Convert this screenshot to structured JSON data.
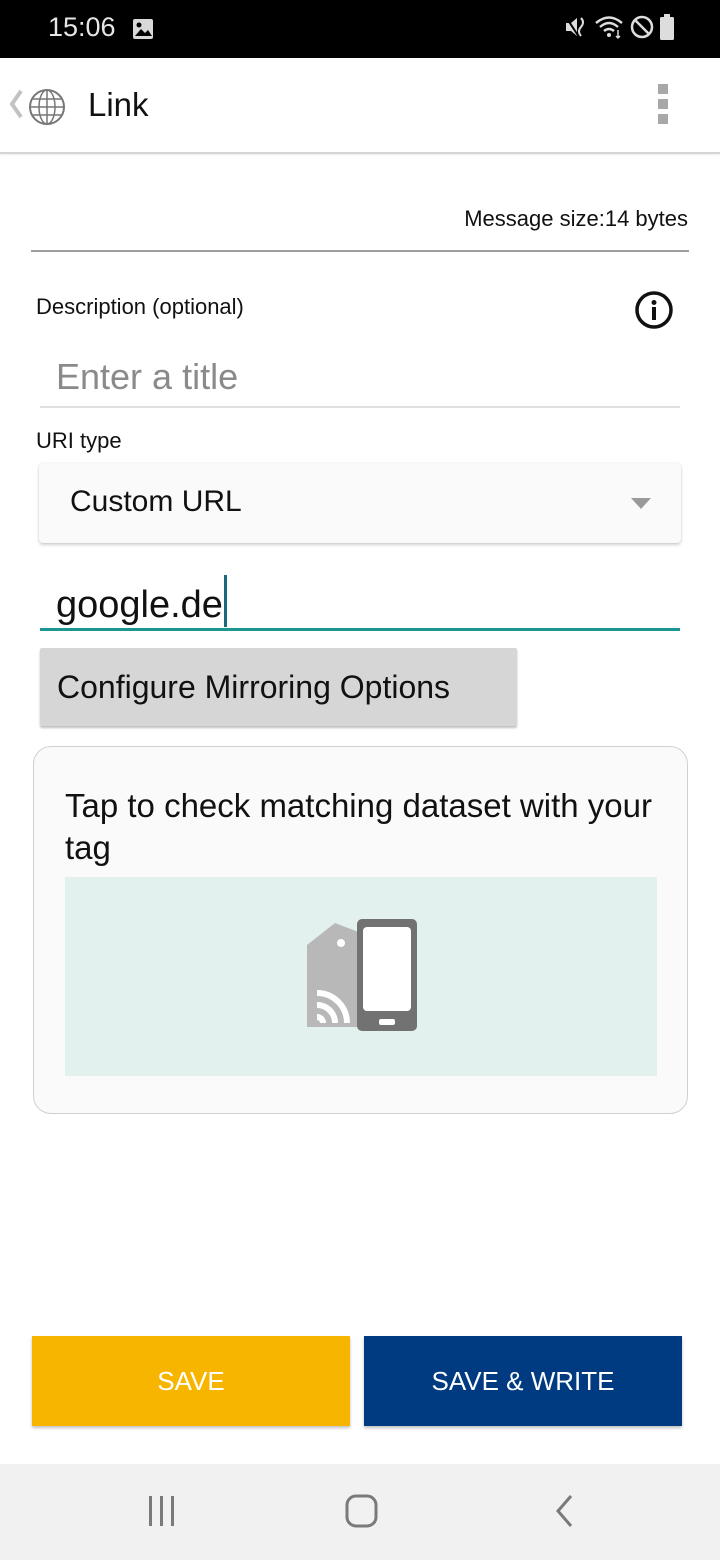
{
  "status_bar": {
    "time": "15:06",
    "left_icons": [
      "image-icon"
    ],
    "right_icons": [
      "vibrate-icon",
      "wifi-icon",
      "do-not-disturb-icon",
      "battery-icon"
    ]
  },
  "app_bar": {
    "title": "Link",
    "icon": "globe-icon",
    "menu_icon": "overflow-menu-icon"
  },
  "form": {
    "message_size": "Message size:14 bytes",
    "description_label": "Description (optional)",
    "description_value": "",
    "description_placeholder": "Enter a title",
    "uri_type_label": "URI type",
    "uri_type_selected": "Custom URL",
    "url_value": "google.de",
    "mirror_button": "Configure Mirroring Options"
  },
  "card": {
    "text": "Tap to check matching dataset with your tag",
    "illustration": "nfc-tag-phone-icon"
  },
  "actions": {
    "save": "SAVE",
    "save_write": "SAVE & WRITE"
  },
  "colors": {
    "save_bg": "#f8b500",
    "save_write_bg": "#003a80",
    "accent": "#1e9690",
    "illustration_bg": "#e2f0ee"
  },
  "nav_bar": {
    "items": [
      "recents-icon",
      "home-icon",
      "back-icon"
    ]
  }
}
